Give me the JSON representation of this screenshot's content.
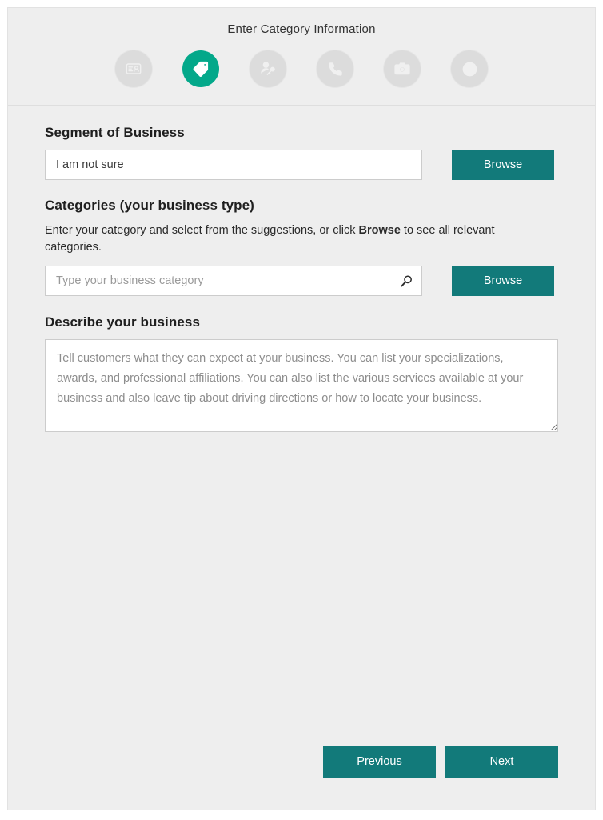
{
  "header": {
    "title": "Enter Category Information",
    "steps": [
      {
        "name": "business-info",
        "icon": "id-card-icon",
        "state": "inactive"
      },
      {
        "name": "category",
        "icon": "tag-icon",
        "state": "active"
      },
      {
        "name": "contact-person",
        "icon": "person-key-icon",
        "state": "inactive"
      },
      {
        "name": "phone",
        "icon": "phone-icon",
        "state": "inactive"
      },
      {
        "name": "photos",
        "icon": "camera-icon",
        "state": "inactive"
      },
      {
        "name": "hours",
        "icon": "clock-icon",
        "state": "inactive"
      }
    ]
  },
  "form": {
    "segment": {
      "label": "Segment of Business",
      "value": "I am not sure",
      "browse_label": "Browse"
    },
    "categories": {
      "label": "Categories (your business type)",
      "helper_prefix": "Enter your category and select from the suggestions, or click ",
      "helper_bold": "Browse",
      "helper_suffix": " to see all relevant categories.",
      "placeholder": "Type your business category",
      "value": "",
      "search_icon": "search-icon",
      "browse_label": "Browse"
    },
    "describe": {
      "label": "Describe your business",
      "placeholder": "Tell customers what they can expect at your business. You can list your specializations, awards, and professional affiliations. You can also list the various services available at your business and also leave tip about driving directions or how to locate your business.",
      "value": ""
    }
  },
  "footer": {
    "previous_label": "Previous",
    "next_label": "Next"
  },
  "colors": {
    "accent_teal": "#127a7a",
    "active_step_green": "#03a88a",
    "page_background": "#eeeeee",
    "inactive_step": "#dcdcdc"
  }
}
